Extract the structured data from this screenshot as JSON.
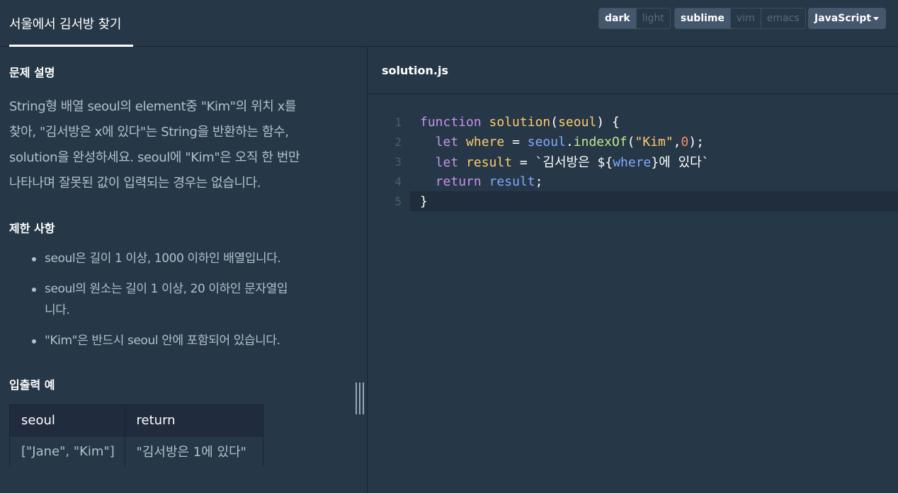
{
  "header": {
    "title": "서울에서 김서방 찾기",
    "theme_options": [
      "dark",
      "light"
    ],
    "theme_selected": "dark",
    "keymap_options": [
      "sublime",
      "vim",
      "emacs"
    ],
    "keymap_selected": "sublime",
    "language": "JavaScript"
  },
  "problem": {
    "description_title": "문제 설명",
    "description_lines": [
      "String형 배열 seoul의 element중 \"Kim\"의 위치 x를",
      "찾아, \"김서방은 x에 있다\"는 String을 반환하는 함수,",
      "solution을 완성하세요. seoul에 \"Kim\"은 오직 한 번만",
      "나타나며 잘못된 값이 입력되는 경우는 없습니다."
    ],
    "constraints_title": "제한 사항",
    "constraints": [
      [
        "seoul은 길이 1 이상, 1000 이하인 배열입니다."
      ],
      [
        "seoul의 원소는 길이 1 이상, 20 이하인 문자열입",
        "니다."
      ],
      [
        "\"Kim\"은 반드시 seoul 안에 포함되어 있습니다."
      ]
    ],
    "examples_title": "입출력 예",
    "examples_table": {
      "headers": [
        "seoul",
        "return"
      ],
      "rows": [
        [
          "[\"Jane\", \"Kim\"]",
          "\"김서방은 1에 있다\""
        ]
      ]
    }
  },
  "editor": {
    "filename": "solution.js",
    "line_numbers": [
      "1",
      "2",
      "3",
      "4",
      "5"
    ],
    "current_line": 5,
    "code": {
      "l1": {
        "kw": "function",
        "fn": "solution",
        "open": "(",
        "param": "seoul",
        "close": ") {"
      },
      "l2": {
        "kw": "let",
        "var": "where",
        "eq": " = ",
        "obj": "seoul",
        "dot": ".",
        "method": "indexOf",
        "p1": "(",
        "str": "\"Kim\"",
        "comma": ",",
        "num": "0",
        "p2": ");"
      },
      "l3": {
        "kw": "let",
        "var": "result",
        "eq": " = ",
        "tpl_start": "`김서방은 ${",
        "ref": "where",
        "tpl_end": "}에 있다`"
      },
      "l4": {
        "kw": "return",
        "ref": "result",
        "semi": ";"
      },
      "l5": {
        "brace": "}"
      }
    }
  },
  "colors": {
    "background": "#263747",
    "table_header": "#202b3d",
    "active_button": "#44576c",
    "keyword": "#c792ea",
    "identifier": "#ffcb6b",
    "property": "#82aaff",
    "method": "#c3e88d",
    "number": "#f78c6c"
  }
}
